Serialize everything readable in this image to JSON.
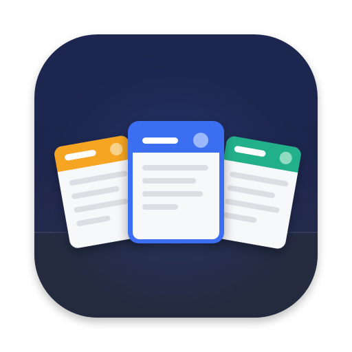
{
  "app_icon": {
    "name": "stacked-cards-app-icon",
    "background_color": "#1f2a4e",
    "shelf_color": "#252b3f",
    "glow_color": "#3a5fb8",
    "cards": [
      {
        "id": "left",
        "header_color": "#f5a524",
        "dot_color": "#f7d38a"
      },
      {
        "id": "center",
        "header_color": "#3b6ef0",
        "dot_color": "#9db7fb"
      },
      {
        "id": "right",
        "header_color": "#23b08a",
        "dot_color": "#8fdcc3"
      }
    ],
    "card_body_color": "#f7f8fa",
    "line_color": "#dcdee3"
  }
}
